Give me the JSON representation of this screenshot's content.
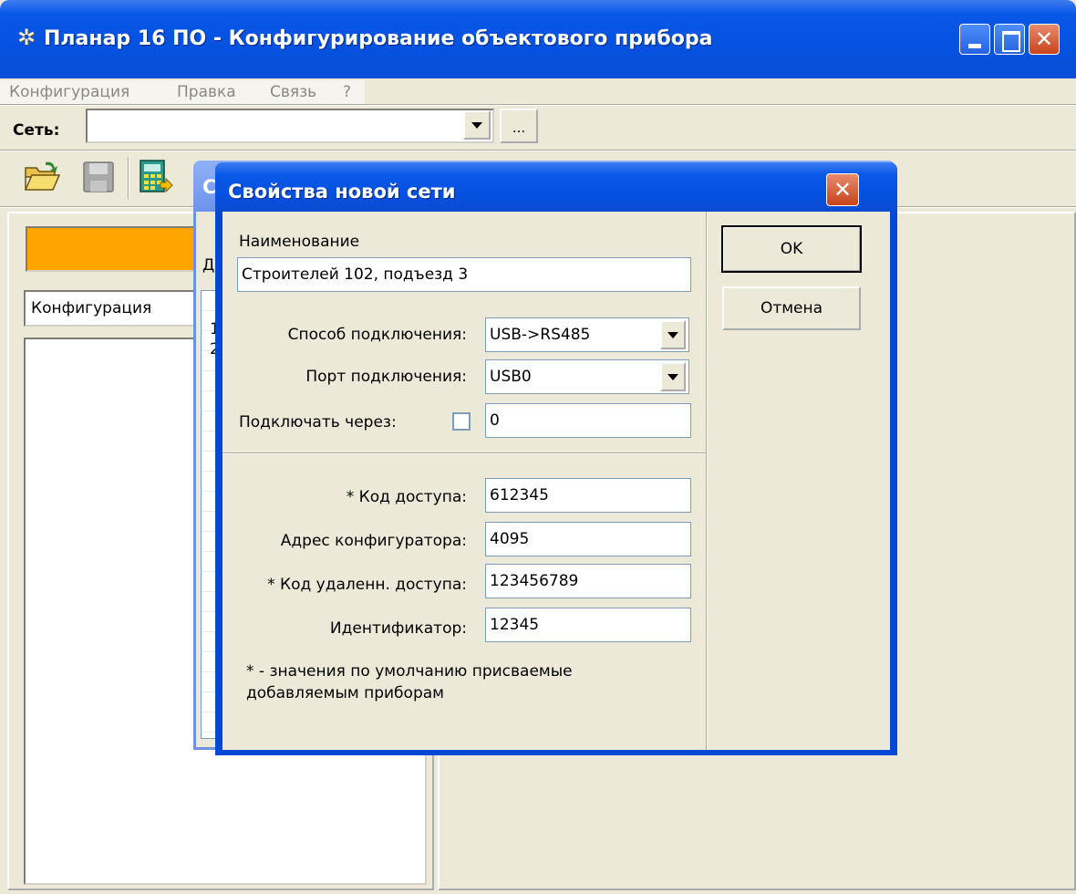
{
  "main_window": {
    "title": "Планар 16 ПО - Конфигурирование объектового прибора",
    "app_icon": "gear-icon",
    "menu": [
      "Конфигурация",
      "Правка",
      "Связь",
      "?"
    ],
    "net_label": "Сеть:",
    "net_value": "",
    "browse_label": "...",
    "toolbar": [
      "open-folder-icon",
      "save-disk-icon",
      "calculator-icon"
    ],
    "left_panel": {
      "config_label": "Конфигурация",
      "tree_items": []
    }
  },
  "background_dialog": {
    "visible_fragments": [
      "С",
      "Д",
      "1",
      "2"
    ]
  },
  "dialog": {
    "title": "Свойства новой сети",
    "name_label": "Наименование",
    "name_value": "Строителей 102, подъезд 3",
    "connection_method_label": "Способ подключения:",
    "connection_method_value": "USB->RS485",
    "connection_port_label": "Порт подключения:",
    "connection_port_value": "USB0",
    "connect_via_label": "Подключать через:",
    "connect_via_checked": false,
    "connect_via_value": "0",
    "access_code_label": "* Код доступа:",
    "access_code_value": "612345",
    "configurator_address_label": "Адрес конфигуратора:",
    "configurator_address_value": "4095",
    "remote_access_code_label": "* Код удаленн. доступа:",
    "remote_access_code_value": "123456789",
    "identifier_label": "Идентификатор:",
    "identifier_value": "12345",
    "footnote": "* - значения по умолчанию присваемые добавляемым приборам",
    "ok_label": "OK",
    "cancel_label": "Отмена"
  },
  "colors": {
    "title_blue": "#0a58e8",
    "window_face": "#ece9d8",
    "status_orange": "#ffa500",
    "close_red": "#c8431c"
  }
}
